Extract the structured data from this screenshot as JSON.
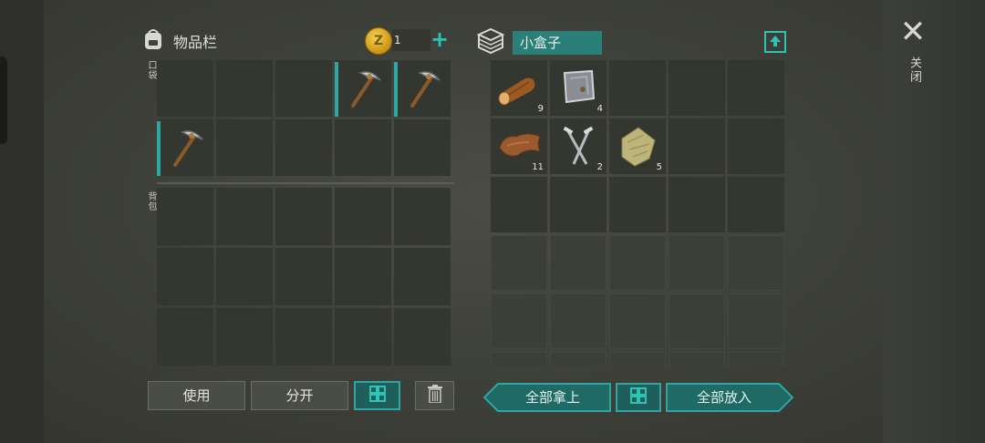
{
  "inventory": {
    "title": "物品栏",
    "gold_count": "1",
    "plus_label": "+",
    "pocket_label": "口袋",
    "backpack_label": "背包",
    "pocket_slots": [
      {
        "item": ""
      },
      {
        "item": ""
      },
      {
        "item": ""
      },
      {
        "item": "pickaxe",
        "bar": true
      },
      {
        "item": "pickaxe",
        "bar": true
      },
      {
        "item": "pickaxe",
        "bar": true
      },
      {
        "item": ""
      },
      {
        "item": ""
      },
      {
        "item": ""
      },
      {
        "item": ""
      }
    ],
    "backpack_slot_count": 15
  },
  "container": {
    "name": "小盒子",
    "slots": [
      {
        "item": "wood-log",
        "qty": "9"
      },
      {
        "item": "metal-plate",
        "qty": "4"
      },
      {
        "item": "",
        "qty": ""
      },
      {
        "item": "",
        "qty": ""
      },
      {
        "item": "",
        "qty": ""
      },
      {
        "item": "leather",
        "qty": "11"
      },
      {
        "item": "nails",
        "qty": "2"
      },
      {
        "item": "cloth",
        "qty": "5"
      },
      {
        "item": "",
        "qty": ""
      },
      {
        "item": "",
        "qty": ""
      },
      {
        "item": "",
        "qty": ""
      },
      {
        "item": "",
        "qty": ""
      },
      {
        "item": "",
        "qty": ""
      },
      {
        "item": "",
        "qty": ""
      },
      {
        "item": "",
        "qty": ""
      }
    ],
    "locked_slot_count": 15
  },
  "close": {
    "icon": "close-icon",
    "label": "关闭"
  },
  "buttons": {
    "use": "使用",
    "split": "分开",
    "take_all": "全部拿上",
    "put_all": "全部放入"
  },
  "colors": {
    "accent": "#2ea7a4",
    "gold": "#e2b22a"
  }
}
